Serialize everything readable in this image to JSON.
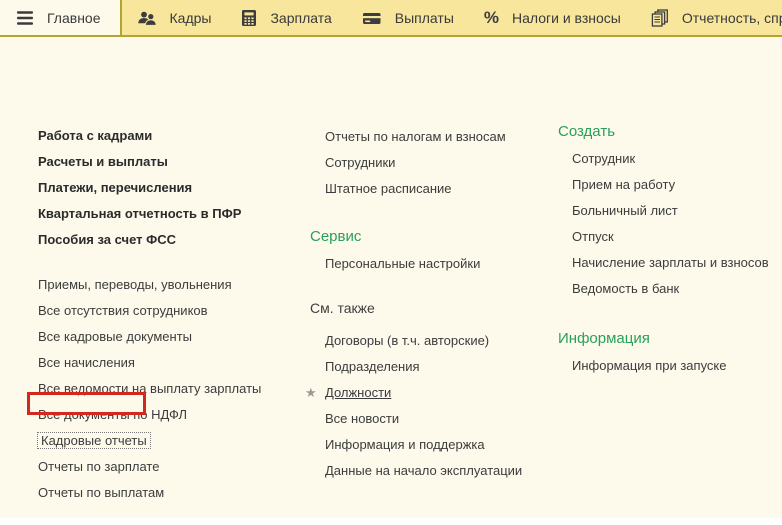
{
  "colors": {
    "tabbar_bg": "#f7e69b",
    "tabbar_border": "#b5a331",
    "content_bg": "#fdfaec",
    "heading_green": "#28a05a",
    "highlight_red": "#d4281e",
    "text": "#3c3c3c"
  },
  "glyphs": {
    "percent": "%",
    "star": "★"
  },
  "tabs": [
    {
      "label": "Главное",
      "icon": "hamburger-icon",
      "active": true
    },
    {
      "label": "Кадры",
      "icon": "people-icon",
      "active": false
    },
    {
      "label": "Зарплата",
      "icon": "calculator-icon",
      "active": false
    },
    {
      "label": "Выплаты",
      "icon": "card-icon",
      "active": false
    },
    {
      "label": "Налоги и взносы",
      "icon": "percent-icon",
      "active": false
    },
    {
      "label": "Отчетность, справки",
      "icon": "documents-icon",
      "active": false
    }
  ],
  "menu": {
    "col1": {
      "bold_items": [
        "Работа с кадрами",
        "Расчеты и выплаты",
        "Платежи, перечисления",
        "Квартальная отчетность в ПФР",
        "Пособия за счет ФСС"
      ],
      "items": [
        "Приемы, переводы, увольнения",
        "Все отсутствия сотрудников",
        "Все кадровые документы",
        "Все начисления",
        "Все ведомости на выплату зарплаты",
        "Все документы по НДФЛ"
      ],
      "highlighted_item": "Кадровые отчеты",
      "items_after": [
        "Отчеты по зарплате",
        "Отчеты по выплатам"
      ]
    },
    "col2": {
      "items_top": [
        "Отчеты по налогам и взносам",
        "Сотрудники",
        "Штатное расписание"
      ],
      "service_heading": "Сервис",
      "service_items": [
        "Персональные настройки"
      ],
      "see_also_label": "См. также",
      "see_also_items": [
        "Договоры (в т.ч. авторские)",
        "Подразделения",
        "Должности",
        "Все новости",
        "Информация и поддержка",
        "Данные на начало эксплуатации"
      ],
      "favorite_item": "Должности"
    },
    "col3": {
      "create_heading": "Создать",
      "create_items": [
        "Сотрудник",
        "Прием на работу",
        "Больничный лист",
        "Отпуск",
        "Начисление зарплаты и взносов",
        "Ведомость в банк"
      ],
      "info_heading": "Информация",
      "info_items": [
        "Информация при запуске"
      ]
    }
  }
}
